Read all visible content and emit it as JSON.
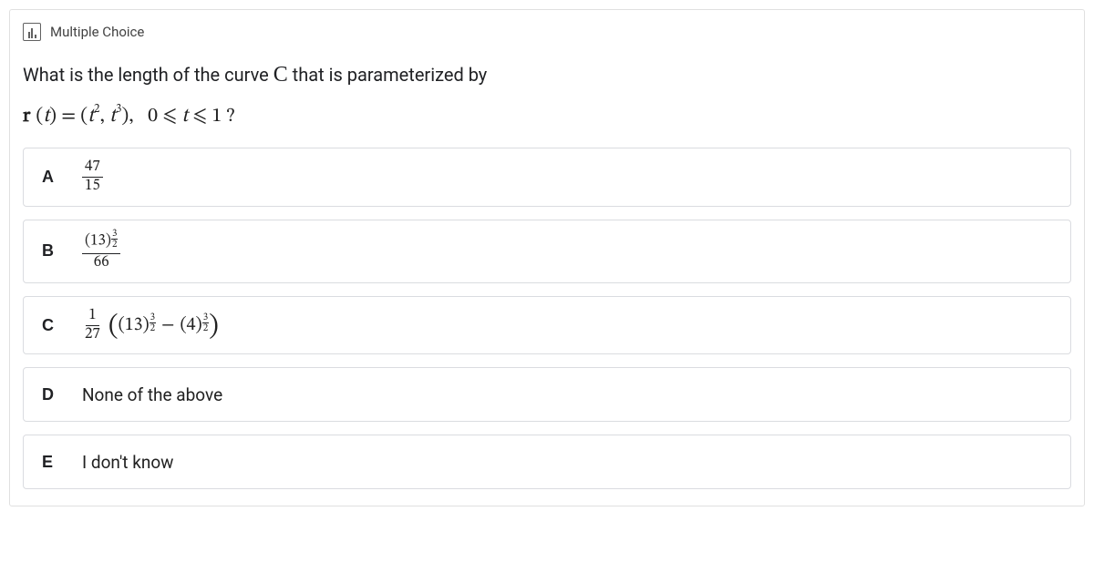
{
  "header": {
    "type_label": "Multiple Choice"
  },
  "question": {
    "prompt_prefix": "What is the length of the curve ",
    "curve_symbol": "C",
    "prompt_suffix": " that is parameterized by",
    "equation": "r(t) = (t², t³),   0 ⩽ t ⩽ 1 ?"
  },
  "options": {
    "A": {
      "letter": "A",
      "value": {
        "numerator": "47",
        "denominator": "15"
      }
    },
    "B": {
      "letter": "B",
      "value": {
        "base": "(13)",
        "exp_num": "3",
        "exp_den": "2",
        "denominator": "66"
      }
    },
    "C": {
      "letter": "C",
      "coef_num": "1",
      "coef_den": "27",
      "term1_base": "(13)",
      "term1_exp_num": "3",
      "term1_exp_den": "2",
      "minus": "−",
      "term2_base": "(4)",
      "term2_exp_num": "3",
      "term2_exp_den": "2"
    },
    "D": {
      "letter": "D",
      "text": "None of the above"
    },
    "E": {
      "letter": "E",
      "text": "I don't know"
    }
  }
}
